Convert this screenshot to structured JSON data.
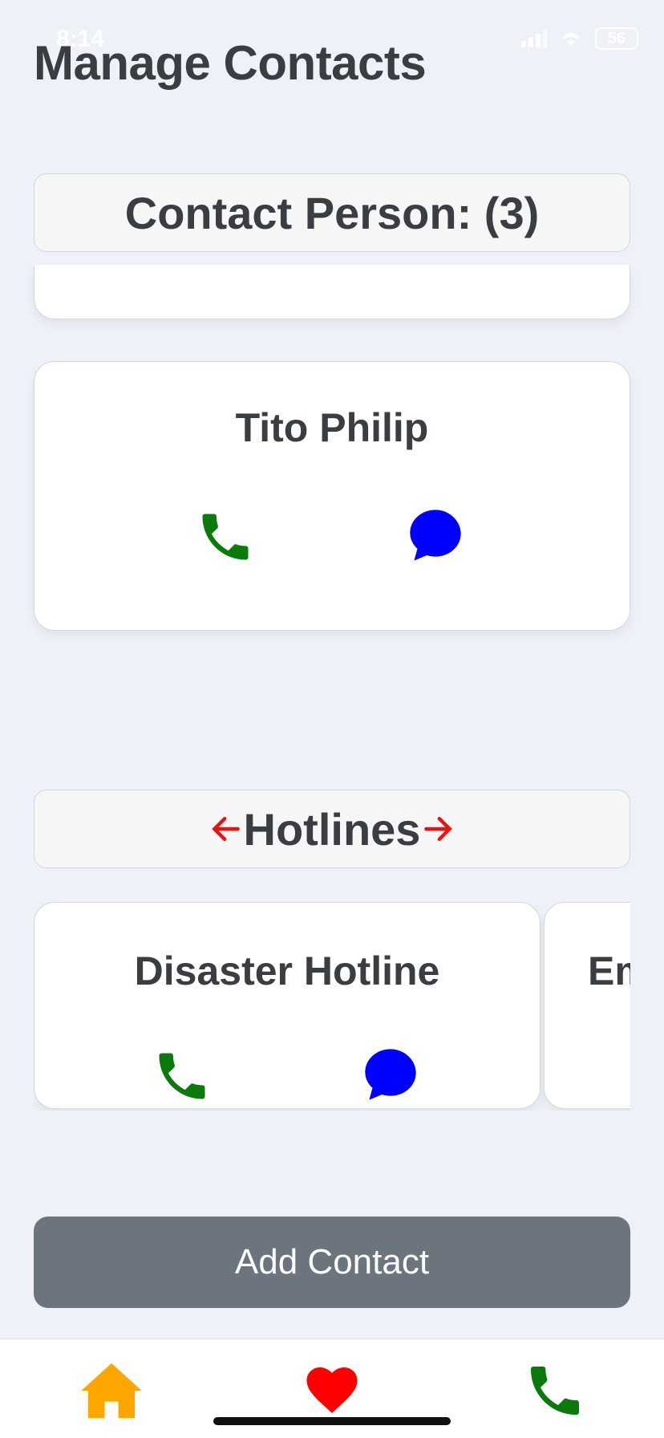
{
  "status": {
    "time": "8:14",
    "battery": "56"
  },
  "title": "Manage Contacts",
  "contacts_section": {
    "header": "Contact Person: (3)"
  },
  "contacts": [
    {
      "name": "Tito Philip"
    }
  ],
  "hotlines_section": {
    "header": "Hotlines"
  },
  "hotlines": [
    {
      "name": "Disaster Hotline"
    },
    {
      "name": "Em"
    }
  ],
  "add_button": "Add Contact",
  "colors": {
    "call": "#0a7a0a",
    "message": "#0000ff",
    "arrow": "#ee1111",
    "home": "#ffa500",
    "heart": "#ff0000",
    "button": "#6c747e"
  },
  "icons": {
    "call": "phone-icon",
    "message": "chat-bubble-icon",
    "home": "home-icon",
    "favorites": "heart-icon",
    "hotline_nav": "phone-icon"
  }
}
